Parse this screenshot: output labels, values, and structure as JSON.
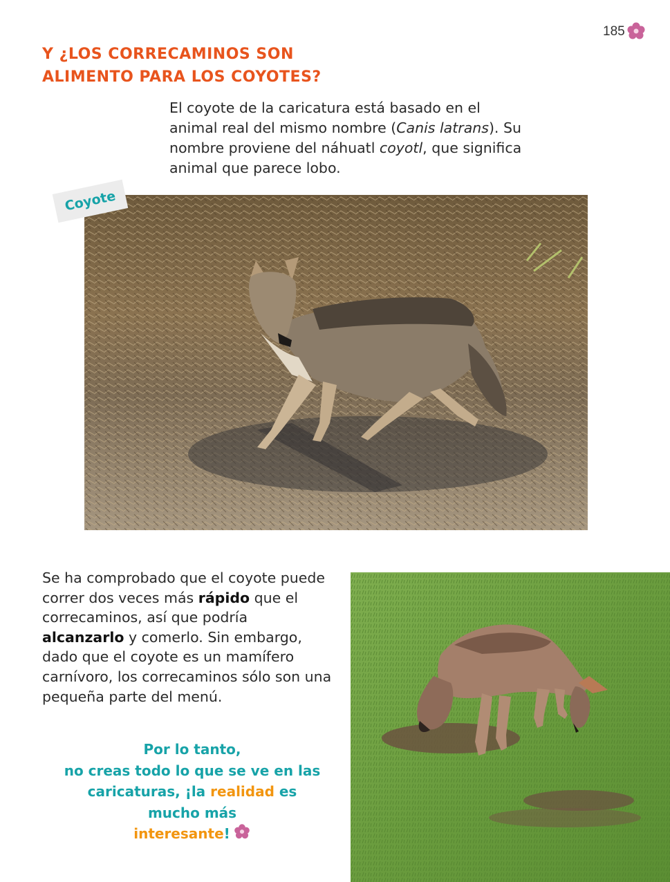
{
  "page": {
    "number": "185"
  },
  "title": {
    "line1": "Y ¿LOS CORRECAMINOS SON",
    "line2": "ALIMENTO PARA LOS COYOTES?"
  },
  "intro": {
    "part1": "El coyote de la caricatura está basado en el animal real del mismo nombre (",
    "scientific_name": "Canis latrans",
    "part2": "). Su nombre proviene del náhuatl ",
    "nahuatl_word": "coyotl",
    "part3": ", que significa animal que parece lobo."
  },
  "photo1": {
    "label": "Coyote"
  },
  "body": {
    "part1": "Se ha comprobado que el coyote puede correr dos veces más ",
    "bold1": "rápido",
    "part2": " que el correcaminos, así que podría ",
    "bold2": "alcanzarlo",
    "part3": " y comerlo. Sin embargo, dado que el coyote es un mamífero carnívoro, los correcaminos sólo son una pequeña parte del menú."
  },
  "conclusion": {
    "line1": "Por lo tanto,",
    "line2": "no creas todo lo que se ve en las",
    "line3_part1": "caricaturas, ¡la ",
    "line3_highlight": "realidad",
    "line3_part2": " es",
    "line4": "mucho más",
    "line5_highlight": "interesante",
    "line5_end": "!"
  },
  "icons": [
    "flower-icon"
  ],
  "colors": {
    "title": "#e8541d",
    "teal": "#17a3a8",
    "orange": "#f2950f",
    "flower": "#c9639a"
  }
}
